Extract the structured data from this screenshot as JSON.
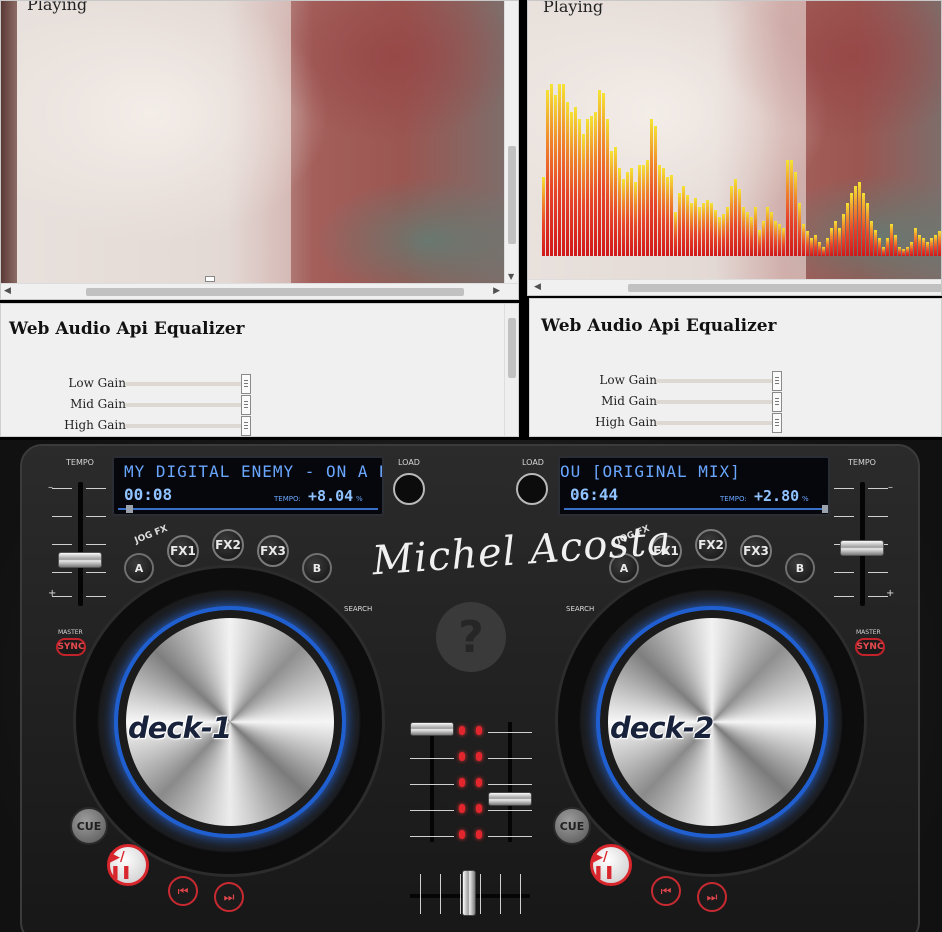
{
  "left_player": {
    "status": "Playing"
  },
  "right_player": {
    "status": "Playing",
    "spectrum_levels": [
      0.45,
      0.95,
      0.98,
      0.92,
      0.98,
      0.98,
      0.88,
      0.82,
      0.85,
      0.78,
      0.7,
      0.78,
      0.8,
      0.82,
      0.95,
      0.93,
      0.78,
      0.6,
      0.62,
      0.5,
      0.44,
      0.48,
      0.5,
      0.42,
      0.52,
      0.52,
      0.55,
      0.78,
      0.74,
      0.52,
      0.5,
      0.45,
      0.46,
      0.25,
      0.36,
      0.4,
      0.35,
      0.3,
      0.33,
      0.28,
      0.3,
      0.32,
      0.3,
      0.26,
      0.22,
      0.24,
      0.28,
      0.4,
      0.44,
      0.38,
      0.28,
      0.25,
      0.22,
      0.28,
      0.15,
      0.2,
      0.28,
      0.25,
      0.2,
      0.18,
      0.16,
      0.55,
      0.55,
      0.48,
      0.3,
      0.18,
      0.14,
      0.1,
      0.12,
      0.08,
      0.05,
      0.1,
      0.16,
      0.2,
      0.16,
      0.24,
      0.3,
      0.36,
      0.4,
      0.42,
      0.36,
      0.3,
      0.2,
      0.15,
      0.1,
      0.05,
      0.1,
      0.18,
      0.12,
      0.05,
      0.04,
      0.05,
      0.08,
      0.16,
      0.12,
      0.1,
      0.08,
      0.1,
      0.12,
      0.14
    ]
  },
  "left_equalizer": {
    "title": "Web Audio Api Equalizer",
    "gains": [
      {
        "label": "Low Gain",
        "value": 1
      },
      {
        "label": "Mid Gain",
        "value": 1
      },
      {
        "label": "High Gain",
        "value": 1
      }
    ]
  },
  "right_equalizer": {
    "title": "Web Audio Api Equalizer",
    "gains": [
      {
        "label": "Low Gain",
        "value": 1
      },
      {
        "label": "Mid Gain",
        "value": 1
      },
      {
        "label": "High Gain",
        "value": 1
      }
    ]
  },
  "controller": {
    "logo": "Michel Acosta",
    "help_symbol": "?",
    "load_label": "LOAD",
    "tempo_label": "TEMPO",
    "master_label": "MASTER",
    "sync_label": "SYNC",
    "cue_label": "CUE",
    "jog_fx_label": "JOG FX",
    "search_label": "SEARCH",
    "fx": [
      "FX1",
      "FX2",
      "FX3"
    ],
    "ctrl_a": "A",
    "ctrl_b": "B",
    "tempo_word": "TEMPO:",
    "plus": "+",
    "minus": "–",
    "deck1": {
      "display_title": "MY DIGITAL ENEMY - ON A RAGG",
      "time": "00:08",
      "tempo": "+8.04",
      "tempo_unit": "%",
      "name": "deck-1",
      "play_symbol": "▶/❚❚",
      "prev_symbol": "⏮",
      "next_symbol": "⏭"
    },
    "deck2": {
      "display_title": "OU [ORIGINAL MIX]",
      "time": "06:44",
      "tempo": "+2.80",
      "tempo_unit": "%",
      "name": "deck-2",
      "play_symbol": "▶/❚❚",
      "prev_symbol": "⏮",
      "next_symbol": "⏭"
    }
  }
}
